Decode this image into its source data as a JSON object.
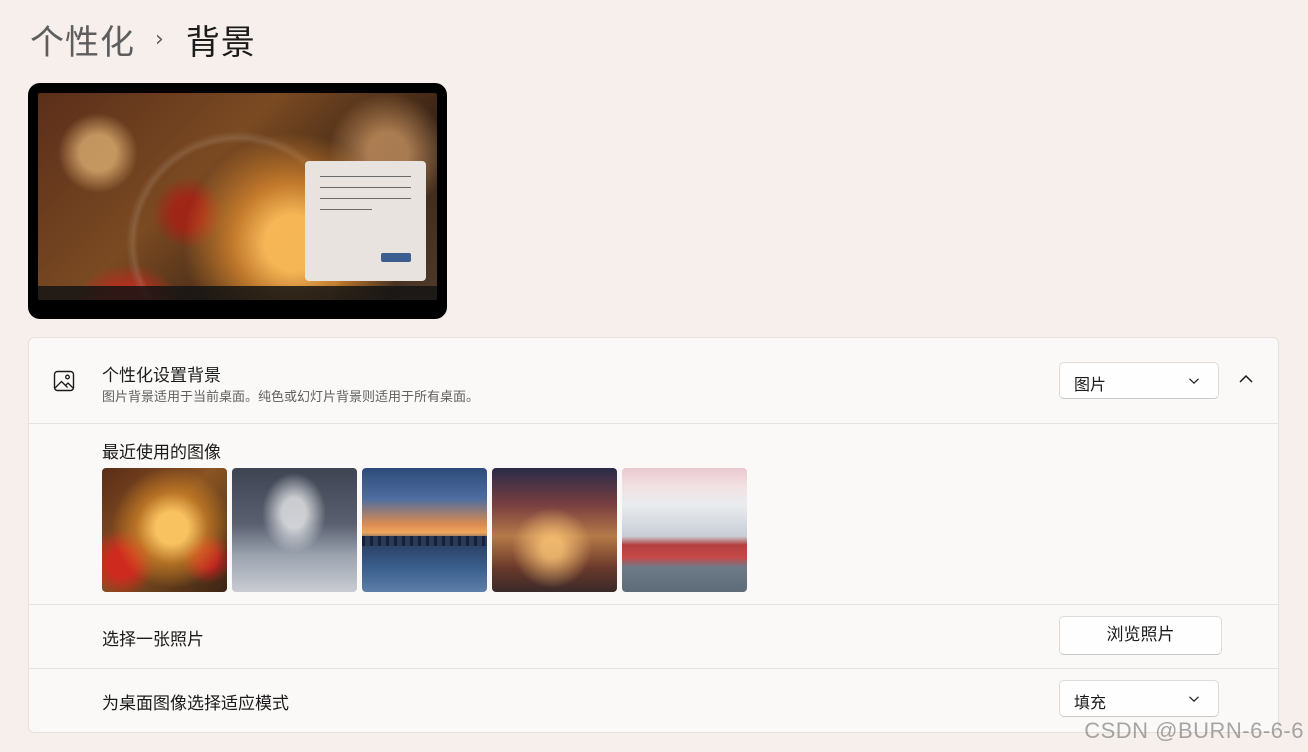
{
  "breadcrumb": {
    "parent": "个性化",
    "separator": "›",
    "current": "背景"
  },
  "background": {
    "title": "个性化设置背景",
    "description": "图片背景适用于当前桌面。纯色或幻灯片背景则适用于所有桌面。",
    "type_value": "图片",
    "recent_label": "最近使用的图像",
    "thumbnails": [
      "snow-globe",
      "cranes",
      "pier-sunset",
      "market-square",
      "red-cabins"
    ],
    "choose_photo_label": "选择一张照片",
    "browse_button": "浏览照片",
    "fit_label": "为桌面图像选择适应模式",
    "fit_value": "填充"
  },
  "watermark": "CSDN @BURN-6-6-6",
  "icons": {
    "image": "image-icon",
    "chevron": "chevron-down-icon",
    "collapse": "chevron-up-icon"
  },
  "colors": {
    "accent": "#3c5f8f",
    "background": "#f7efeb"
  }
}
